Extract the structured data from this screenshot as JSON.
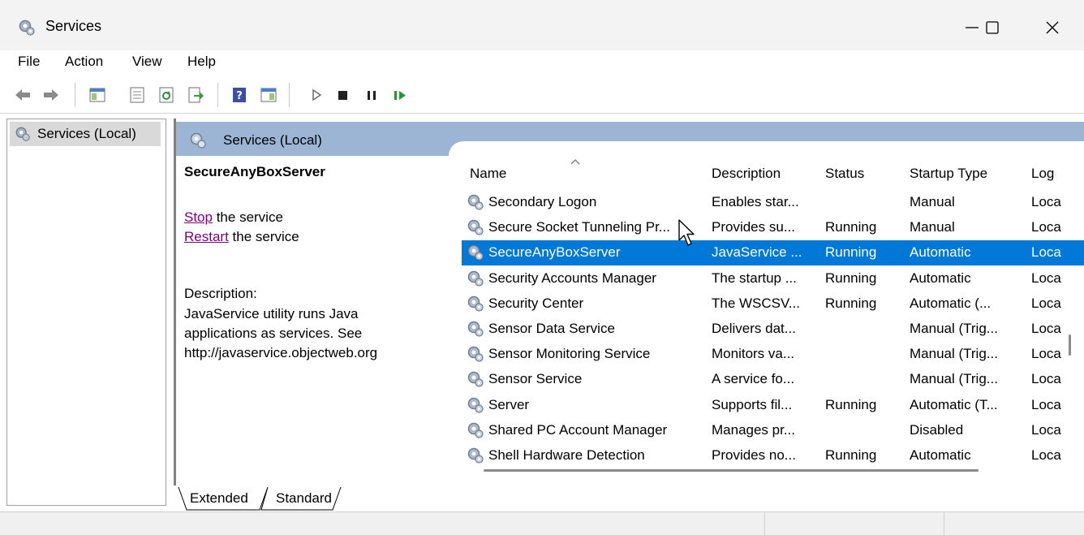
{
  "window": {
    "title": "Services",
    "app_icon": "gears-icon"
  },
  "menu": [
    "File",
    "Action",
    "View",
    "Help"
  ],
  "toolbar": {
    "buttons": [
      "back-arrow-icon",
      "forward-arrow-icon",
      "show-hide-console-tree-icon",
      "properties-icon",
      "refresh-icon",
      "export-list-icon",
      "help-icon",
      "show-hide-action-pane-icon",
      "start-service-icon",
      "stop-service-icon",
      "pause-service-icon",
      "resume-service-icon"
    ]
  },
  "tree": {
    "node_label": "Services (Local)"
  },
  "pane": {
    "header_title": "Services (Local)"
  },
  "details": {
    "service_name": "SecureAnyBoxServer",
    "stop_link": "Stop",
    "stop_suffix": " the service",
    "restart_link": "Restart",
    "restart_suffix": " the service",
    "description_label": "Description:",
    "description_text": "JavaService utility runs Java applications as services. See http://javaservice.objectweb.org"
  },
  "list": {
    "columns": [
      "Name",
      "Description",
      "Status",
      "Startup Type",
      "Log"
    ],
    "sorted_by": "Name",
    "rows": [
      {
        "name": "Secondary Logon",
        "description": "Enables star...",
        "status": "",
        "startup": "Manual",
        "log": "Loca"
      },
      {
        "name": "Secure Socket Tunneling Pr...",
        "description": "Provides su...",
        "status": "Running",
        "startup": "Manual",
        "log": "Loca"
      },
      {
        "name": "SecureAnyBoxServer",
        "description": "JavaService ...",
        "status": "Running",
        "startup": "Automatic",
        "log": "Loca",
        "selected": true
      },
      {
        "name": "Security Accounts Manager",
        "description": "The startup ...",
        "status": "Running",
        "startup": "Automatic",
        "log": "Loca"
      },
      {
        "name": "Security Center",
        "description": "The WSCSV...",
        "status": "Running",
        "startup": "Automatic (...",
        "log": "Loca"
      },
      {
        "name": "Sensor Data Service",
        "description": "Delivers dat...",
        "status": "",
        "startup": "Manual (Trig...",
        "log": "Loca"
      },
      {
        "name": "Sensor Monitoring Service",
        "description": "Monitors va...",
        "status": "",
        "startup": "Manual (Trig...",
        "log": "Loca"
      },
      {
        "name": "Sensor Service",
        "description": "A service fo...",
        "status": "",
        "startup": "Manual (Trig...",
        "log": "Loca"
      },
      {
        "name": "Server",
        "description": "Supports fil...",
        "status": "Running",
        "startup": "Automatic (T...",
        "log": "Loca"
      },
      {
        "name": "Shared PC Account Manager",
        "description": "Manages pr...",
        "status": "",
        "startup": "Disabled",
        "log": "Loca"
      },
      {
        "name": "Shell Hardware Detection",
        "description": "Provides no...",
        "status": "Running",
        "startup": "Automatic",
        "log": "Loca"
      }
    ]
  },
  "tabs": {
    "extended": "Extended",
    "standard": "Standard",
    "active": "Extended"
  },
  "colors": {
    "selection": "#0078d7",
    "header_band": "#9db5d4",
    "link": "#800080"
  }
}
